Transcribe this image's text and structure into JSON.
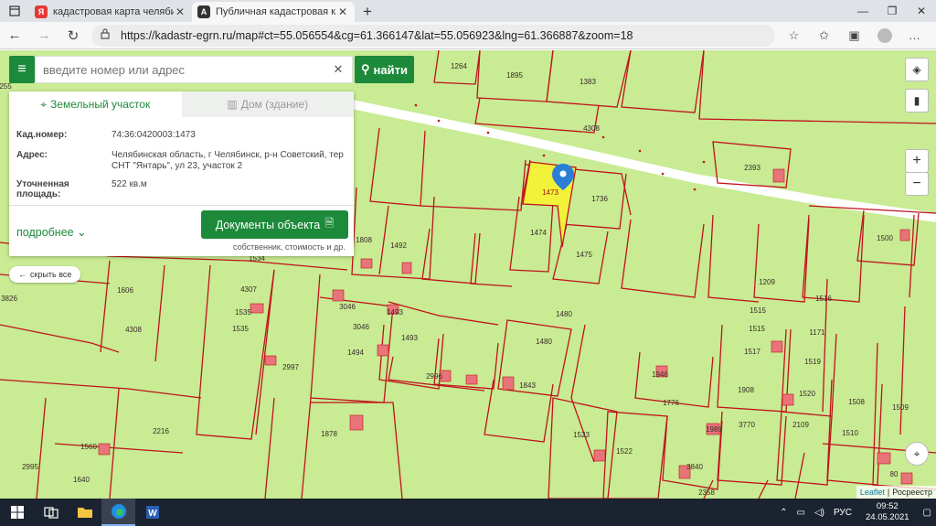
{
  "browser": {
    "tabs": [
      {
        "title": "кадастровая карта челябинской",
        "favicon": "Я",
        "color": "#e53935"
      },
      {
        "title": "Публичная кадастровая карта с",
        "favicon": "A",
        "color": "#333333"
      }
    ],
    "url": "https://kadastr-egrn.ru/map#ct=55.056554&cg=61.366147&lat=55.056923&lng=61.366887&zoom=18"
  },
  "search": {
    "placeholder": "введите номер или адрес",
    "button": "найти"
  },
  "card": {
    "tab_land": "Земельный участок",
    "tab_house": "Дом (здание)",
    "rows": [
      {
        "label": "Кад.номер:",
        "value": "74:36:0420003:1473"
      },
      {
        "label": "Адрес:",
        "value": "Челябинская область, г Челябинск, р-н Советский, тер СНТ \"Янтарь\", ул 23, участок 2"
      },
      {
        "label": "Уточненная площадь:",
        "value": "522 кв.м"
      }
    ],
    "more": "подробнее",
    "docs_button": "Документы объекта",
    "docs_note": "собственник, стоимость и др."
  },
  "hide_all": "скрыть все",
  "map": {
    "zoom_in": "+",
    "zoom_out": "−",
    "attribution_leaflet": "Leaflet",
    "attribution_sep": "|",
    "attribution_source": "Росреестр",
    "parcel_labels": [
      "1264",
      "1895",
      "1383",
      "4308",
      "2393",
      "1473",
      "1736",
      "1474",
      "1475",
      "1808",
      "1492",
      "1500",
      "4307",
      "1606",
      "1209",
      "1516",
      "1535",
      "1535",
      "3046",
      "3046",
      "1493",
      "1480",
      "1515",
      "1515",
      "1171",
      "1494",
      "1493",
      "1480",
      "1517",
      "1519",
      "2997",
      "2996",
      "1843",
      "1946",
      "1908",
      "1520",
      "1508",
      "1509",
      "1776",
      "1878",
      "2216",
      "1523",
      "1522",
      "1989",
      "3770",
      "2109",
      "1510",
      "1560",
      "2995",
      "1640",
      "3840",
      "2358",
      "80",
      "3826",
      "4308",
      "255",
      "1534"
    ]
  },
  "taskbar": {
    "lang": "РУС",
    "time": "09:52",
    "date": "24.05.2021"
  }
}
